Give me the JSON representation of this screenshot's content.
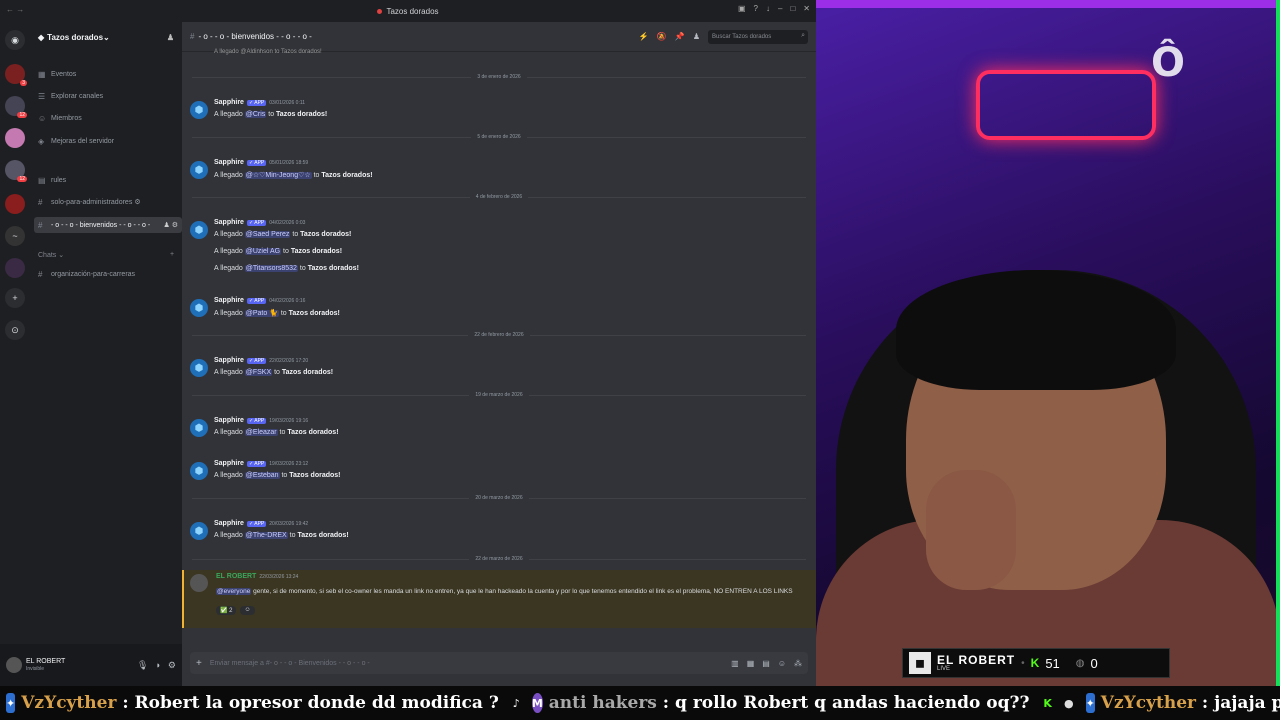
{
  "window": {
    "title": "Tazos dorados"
  },
  "server": {
    "name": "Tazos dorados",
    "rail_badges": [
      "3",
      "12",
      "12"
    ]
  },
  "sidebar": {
    "items": [
      {
        "label": "Eventos"
      },
      {
        "label": "Explorar canales"
      },
      {
        "label": "Miembros"
      },
      {
        "label": "Mejoras del servidor"
      }
    ],
    "channels": [
      {
        "label": "rules"
      },
      {
        "label": "solo-para-administradores"
      },
      {
        "label": "- o - - o - bienvenidos - - o - - o -"
      }
    ],
    "category": "Chats",
    "category_channels": [
      {
        "label": "organización-para-carreras"
      }
    ]
  },
  "user": {
    "name": "EL ROBERT",
    "status": "Invisible"
  },
  "channel": {
    "name": "- o - - o - bienvenidos - - o - - o -",
    "search_placeholder": "Buscar Tazos dorados"
  },
  "messages": {
    "top_fragment": "A llegado @Aldinhson to Tazos dorados!",
    "groups": [
      {
        "date": "3 de enero de 2026",
        "author": "Sapphire",
        "badge": "✓ APP",
        "time": "03/01/2026 0:11",
        "lines": [
          {
            "mention": "@Cris",
            "suffix": " to ",
            "server": "Tazos dorados!"
          }
        ]
      },
      {
        "date": "5 de enero de 2026",
        "author": "Sapphire",
        "badge": "✓ APP",
        "time": "05/01/2026 18:59",
        "lines": [
          {
            "mention": "@☆♡Min-Jeong♡☆",
            "suffix": " to ",
            "server": "Tazos dorados!"
          }
        ]
      },
      {
        "date": "4 de febrero de 2026",
        "author": "Sapphire",
        "badge": "✓ APP",
        "time": "04/02/2026 0:03",
        "lines": [
          {
            "mention": "@Saed Perez",
            "suffix": " to ",
            "server": "Tazos dorados!"
          },
          {
            "mention": "@Uziel AG",
            "suffix": " to ",
            "server": "Tazos dorados!"
          },
          {
            "mention": "@Titansors8532",
            "suffix": " to ",
            "server": "Tazos dorados!"
          }
        ]
      },
      {
        "date": "",
        "author": "Sapphire",
        "badge": "✓ APP",
        "time": "04/02/2026 0:16",
        "lines": [
          {
            "mention": "@Pato 🐈",
            "suffix": " to ",
            "server": "Tazos dorados!"
          }
        ]
      },
      {
        "date": "22 de febrero de 2026",
        "author": "Sapphire",
        "badge": "✓ APP",
        "time": "22/02/2026 17:20",
        "lines": [
          {
            "mention": "@FSKX",
            "suffix": " to ",
            "server": "Tazos dorados!"
          }
        ]
      },
      {
        "date": "19 de marzo de 2026",
        "author": "Sapphire",
        "badge": "✓ APP",
        "time": "19/03/2026 19:16",
        "lines": [
          {
            "mention": "@Eleazar",
            "suffix": " to ",
            "server": "Tazos dorados!"
          }
        ]
      },
      {
        "date": "",
        "author": "Sapphire",
        "badge": "✓ APP",
        "time": "19/03/2026 23:12",
        "lines": [
          {
            "mention": "@Esteban",
            "suffix": " to ",
            "server": "Tazos dorados!"
          }
        ]
      },
      {
        "date": "20 de marzo de 2026",
        "author": "Sapphire",
        "badge": "✓ APP",
        "time": "20/03/2026 19:42",
        "lines": [
          {
            "mention": "@The-DREX",
            "suffix": " to ",
            "server": "Tazos dorados!"
          }
        ]
      }
    ],
    "prefix": "A llegado ",
    "last_date": "22 de marzo de 2026",
    "robert": {
      "author": "EL ROBERT",
      "time": "22/03/2026 13:24",
      "mention": "@everyone",
      "text": " gente, si de momento, si seb el co-owner les manda un link no entren, ya que  le han hackeado la cuenta y por lo que tenemos entendido el link es el problema, NO ENTREN A LOS LINKS",
      "reaction_count": "2"
    }
  },
  "composer": {
    "placeholder": "Enviar mensaje a #- o - - o - Bienvenidos - - o - - o -"
  },
  "stream": {
    "streamer": "EL ROBERT",
    "live": "LIVE",
    "followers": "51",
    "viewers": "0",
    "sign_text": "Ô"
  },
  "ticker": [
    {
      "user": "VzYcyther",
      "msg": "Robert la opresor donde dd modifica ?"
    },
    {
      "user": "anti hakers",
      "msg": "q rollo Robert q andas haciendo oq??"
    },
    {
      "user": "VzYcyther",
      "msg": "jajaja porque"
    }
  ],
  "colors": {
    "accent": "#5865f2",
    "kick_green": "#53fc18",
    "highlight": "#f0b232"
  }
}
